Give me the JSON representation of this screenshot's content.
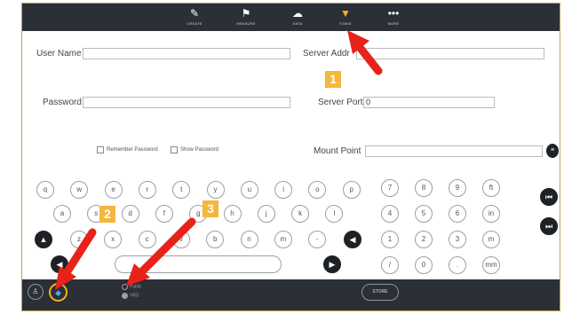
{
  "toolbar": {
    "items": [
      {
        "label": "CREATE",
        "icon": "pencil-icon"
      },
      {
        "label": "MEASURE",
        "icon": "flag-icon"
      },
      {
        "label": "DATA",
        "icon": "cloud-sync-icon"
      },
      {
        "label": "STAKE",
        "icon": "stake-pin-icon",
        "active": true
      },
      {
        "label": "MORE",
        "icon": "more-dots-icon"
      }
    ]
  },
  "form": {
    "username_label": "User Name",
    "username_value": "",
    "password_label": "Password",
    "password_value": "",
    "server_address_label": "Server Addr",
    "server_address_value": "",
    "server_port_label": "Server Port",
    "server_port_value": "0",
    "mount_point_label": "Mount Point",
    "mount_point_value": "",
    "remember_password_label": "Remember Password",
    "show_password_label": "Show Password"
  },
  "keyboard": {
    "row1": [
      "q",
      "w",
      "e",
      "r",
      "t",
      "y",
      "u",
      "i",
      "o",
      "p"
    ],
    "row2": [
      "a",
      "s",
      "d",
      "f",
      "g",
      "h",
      "j",
      "k",
      "l"
    ],
    "row3": [
      "z",
      "x",
      "c",
      "v",
      "b",
      "n",
      "m",
      "-"
    ],
    "numpad": [
      [
        "7",
        "8",
        "9",
        "ft"
      ],
      [
        "4",
        "5",
        "6",
        "in"
      ],
      [
        "1",
        "2",
        "3",
        "m"
      ],
      [
        "/",
        "0",
        ".",
        "mm"
      ]
    ],
    "shift_glyph": "▲",
    "backspace_glyph": "◀",
    "left_glyph": "◀",
    "right_glyph": "▶",
    "prev_glyph": "⏮",
    "next_glyph": "⏭"
  },
  "bottombar": {
    "radio_options": [
      {
        "label": "Public",
        "selected": false
      },
      {
        "label": "VRS",
        "selected": true
      }
    ],
    "store_label": "STORE"
  },
  "annotations": {
    "badges": [
      "1",
      "2",
      "3"
    ],
    "accent_color": "#f4b73a",
    "arrow_color": "#e8221b"
  }
}
